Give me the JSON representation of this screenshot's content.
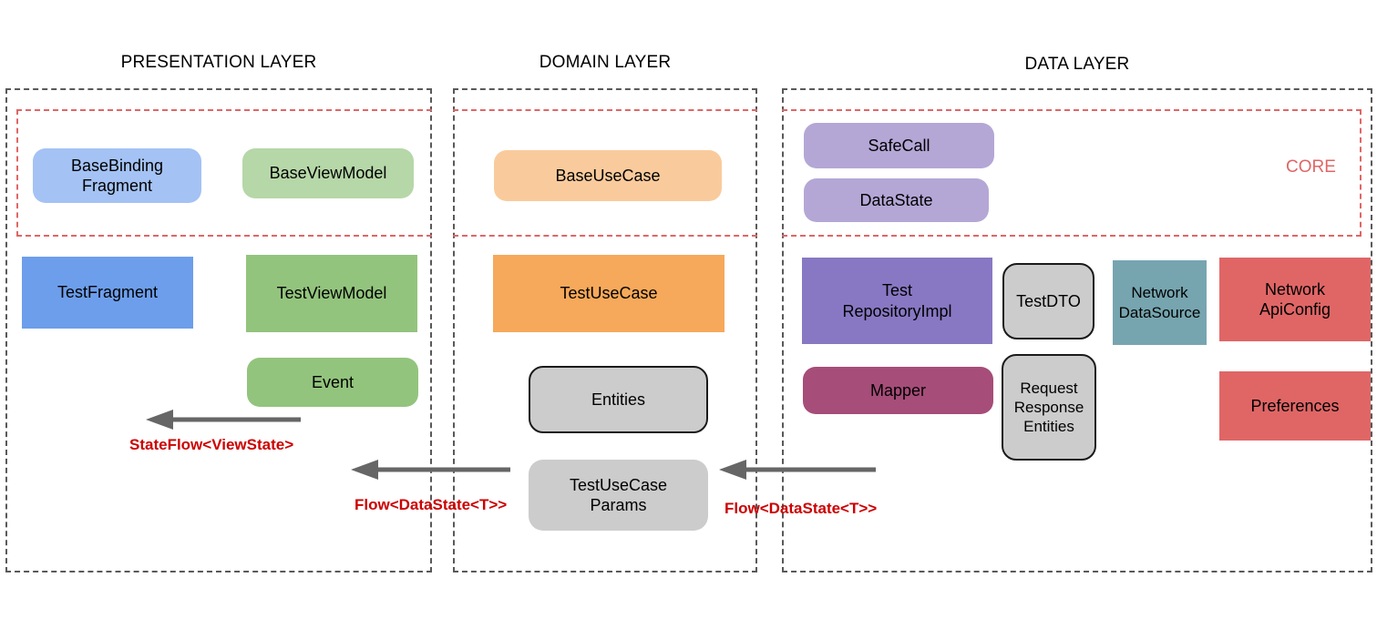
{
  "diagram": {
    "title_presentation": "PRESENTATION LAYER",
    "title_domain": "DOMAIN LAYER",
    "title_data": "DATA LAYER",
    "core_label": "CORE"
  },
  "colors": {
    "light_blue": "#A4C2F4",
    "blue": "#6D9EEB",
    "light_green": "#B6D7A8",
    "green": "#93C47D",
    "light_orange": "#F9CB9C",
    "orange": "#F6A95A",
    "light_purple": "#B4A7D6",
    "purple": "#8878C3",
    "magenta": "#A64D79",
    "teal": "#76A5AF",
    "red": "#E06666",
    "grey": "#CCCCCC",
    "dashed_layer": "#595959",
    "dashed_core": "#E06666",
    "arrow": "#666666",
    "arrow_label": "#CC0000"
  },
  "presentation": {
    "core_nodes": [
      {
        "label": "BaseBinding\nFragment"
      },
      {
        "label": "BaseViewModel"
      }
    ],
    "nodes": [
      {
        "label": "TestFragment"
      },
      {
        "label": "TestViewModel"
      },
      {
        "label": "Event"
      }
    ]
  },
  "domain": {
    "core_nodes": [
      {
        "label": "BaseUseCase"
      }
    ],
    "nodes": [
      {
        "label": "TestUseCase"
      },
      {
        "label": "Entities"
      },
      {
        "label": "TestUseCase\nParams"
      }
    ]
  },
  "data": {
    "core_nodes": [
      {
        "label": "SafeCall"
      },
      {
        "label": "DataState"
      }
    ],
    "nodes": [
      {
        "label": "Test\nRepositoryImpl"
      },
      {
        "label": "TestDTO"
      },
      {
        "label": "Network\nDataSource"
      },
      {
        "label": "Network\nApiConfig"
      },
      {
        "label": "Mapper"
      },
      {
        "label": "Request\nResponse\nEntities"
      },
      {
        "label": "Preferences"
      }
    ]
  },
  "arrows": [
    {
      "label": "StateFlow<ViewState>"
    },
    {
      "label": "Flow<DataState<T>>"
    },
    {
      "label": "Flow<DataState<T>>"
    }
  ]
}
